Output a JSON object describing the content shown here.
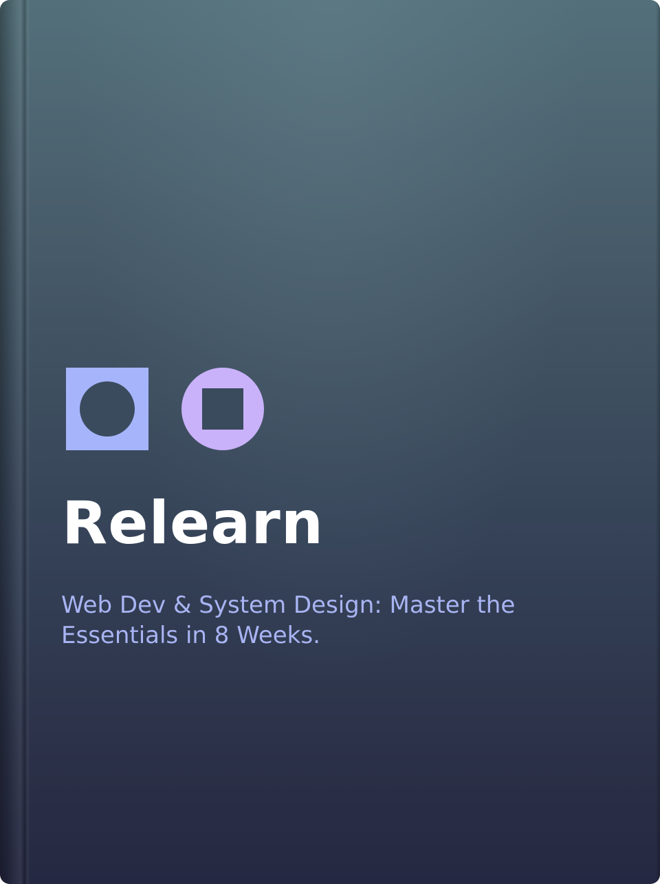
{
  "cover": {
    "title": "Relearn",
    "subtitle": "Web Dev & System Design: Master the Essentials in 8 Weeks."
  },
  "logo": {
    "icons": [
      "square-with-circle-icon",
      "circle-with-square-icon"
    ],
    "colors": {
      "square_fill": "#a6b4fb",
      "circle_fill": "#c9b2fa",
      "cutout": "#3a4b5d"
    }
  },
  "colors": {
    "background_top": "#53707a",
    "background_bottom": "#252841",
    "title": "#ffffff",
    "subtitle": "#a9b4f3"
  }
}
